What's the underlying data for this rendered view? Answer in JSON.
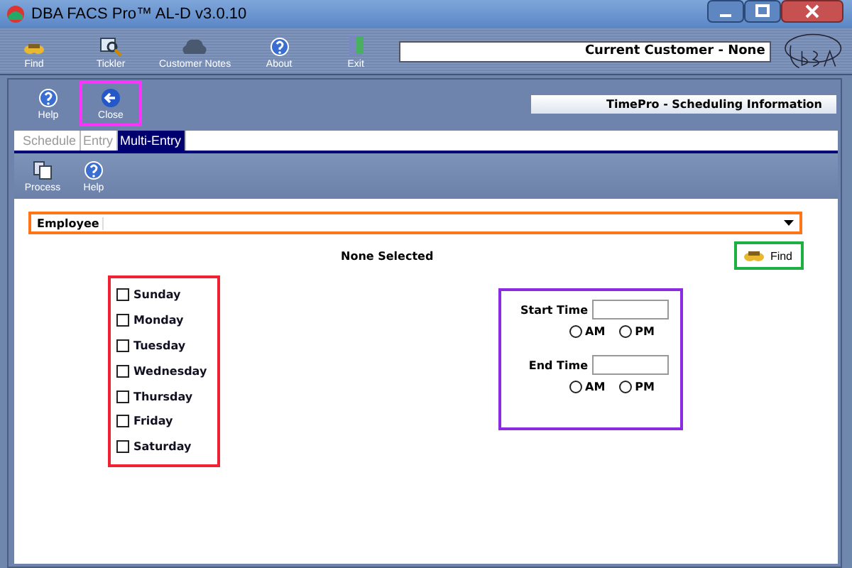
{
  "window": {
    "title": "DBA FACS Pro™ AL-D v3.0.10"
  },
  "main_toolbar": [
    {
      "label": "Find",
      "kind": "find"
    },
    {
      "label": "Tickler",
      "kind": "tickler"
    },
    {
      "label": "Customer Notes",
      "kind": "notes"
    },
    {
      "label": "About",
      "kind": "help"
    },
    {
      "label": "Exit",
      "kind": "exit"
    }
  ],
  "current_customer": "Current Customer - None",
  "panel_toolbar": [
    {
      "label": "Help",
      "kind": "help"
    },
    {
      "label": "Close",
      "kind": "close"
    }
  ],
  "panel_title": "TimePro - Scheduling Information",
  "tabs": [
    {
      "label": "Schedule",
      "selected": false
    },
    {
      "label": "Entry",
      "selected": false
    },
    {
      "label": "Multi-Entry",
      "selected": true
    }
  ],
  "tab_toolbar": [
    {
      "label": "Process",
      "kind": "process"
    },
    {
      "label": "Help",
      "kind": "help"
    }
  ],
  "employee": {
    "label": "Employee"
  },
  "selection_status": "None Selected",
  "find_button": "Find",
  "days": [
    {
      "label": "Sunday",
      "checked": false
    },
    {
      "label": "Monday",
      "checked": false
    },
    {
      "label": "Tuesday",
      "checked": false
    },
    {
      "label": "Wednesday",
      "checked": false
    },
    {
      "label": "Thursday",
      "checked": false
    },
    {
      "label": "Friday",
      "checked": false
    },
    {
      "label": "Saturday",
      "checked": false
    }
  ],
  "times": [
    {
      "label": "Start Time",
      "options": [
        {
          "label": "AM",
          "selected": false
        },
        {
          "label": "PM",
          "selected": false
        }
      ]
    },
    {
      "label": "End Time",
      "options": [
        {
          "label": "AM",
          "selected": false
        },
        {
          "label": "PM",
          "selected": false
        }
      ]
    }
  ]
}
